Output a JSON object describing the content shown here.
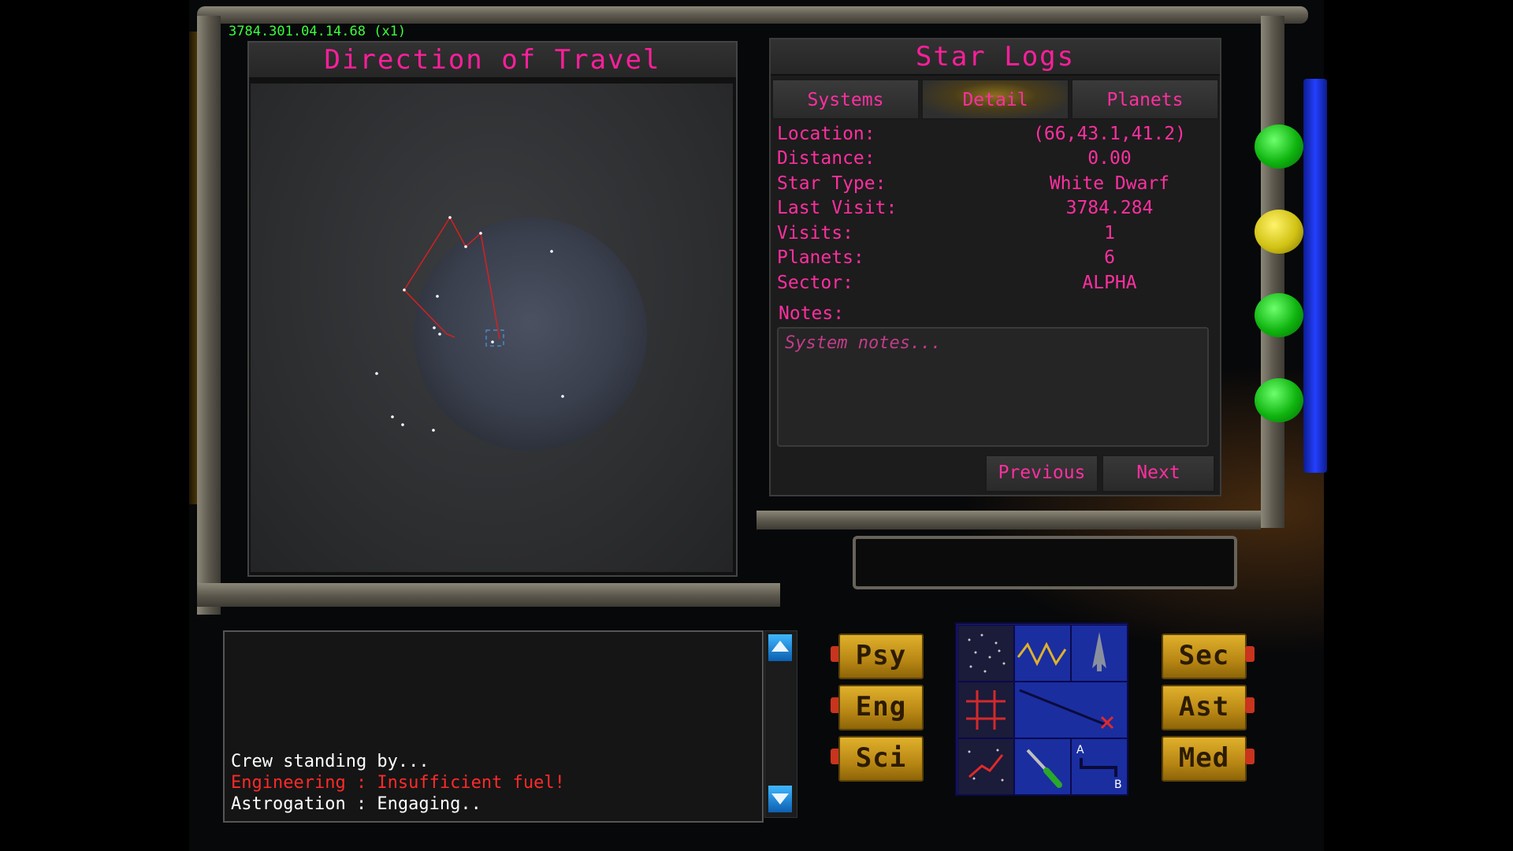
{
  "timestamp": "3784.301.04.14.68 (x1)",
  "direction_panel": {
    "title": "Direction of Travel"
  },
  "star_logs": {
    "title": "Star Logs",
    "tabs": [
      {
        "label": "Systems",
        "active": false
      },
      {
        "label": "Detail",
        "active": true
      },
      {
        "label": "Planets",
        "active": false
      }
    ],
    "fields": [
      {
        "label": "Location:",
        "value": "(66,43.1,41.2)"
      },
      {
        "label": "Distance:",
        "value": "0.00"
      },
      {
        "label": "Star Type:",
        "value": "White Dwarf"
      },
      {
        "label": "Last Visit:",
        "value": "3784.284"
      },
      {
        "label": "Visits:",
        "value": "1"
      },
      {
        "label": "Planets:",
        "value": "6"
      },
      {
        "label": "Sector:",
        "value": "ALPHA"
      }
    ],
    "notes_label": "Notes:",
    "notes_placeholder": "System notes...",
    "previous_label": "Previous",
    "next_label": "Next"
  },
  "status_lights": [
    "green",
    "yellow",
    "green",
    "green"
  ],
  "log": {
    "lines": [
      {
        "text": "Crew standing by...",
        "color": "#ffffff"
      },
      {
        "text": "Engineering : Insufficient fuel!",
        "color": "#ff2a2a"
      },
      {
        "text": "Astrogation : Engaging..",
        "color": "#ffffff"
      }
    ]
  },
  "officers_left": [
    "Psy",
    "Eng",
    "Sci"
  ],
  "officers_right": [
    "Sec",
    "Ast",
    "Med"
  ],
  "icons": [
    "starmap-icon",
    "sine-wave-icon",
    "ship-icon",
    "target-grid-icon",
    "route-line-icon",
    "",
    "trajectory-icon",
    "wrench-icon",
    "a-to-b-icon"
  ],
  "colors": {
    "accent": "#ff1f9b",
    "timestamp": "#3bff3b",
    "officer": "#e0b02c"
  }
}
